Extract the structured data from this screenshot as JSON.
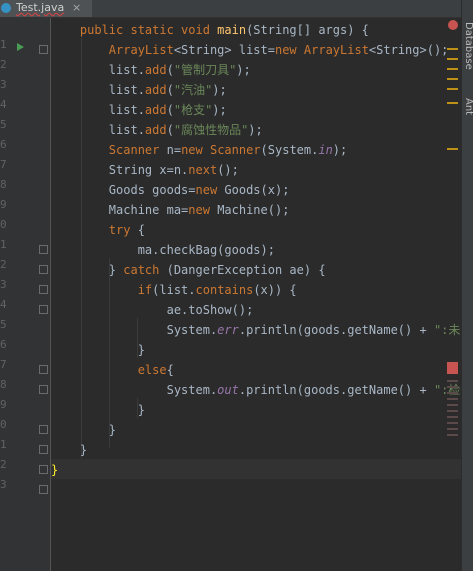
{
  "tab": {
    "label": "Test.java",
    "close": "×"
  },
  "line_numbers": [
    "1",
    "2",
    "3",
    "4",
    "5",
    "6",
    "7",
    "8",
    "9",
    "0",
    "1",
    "2",
    "3",
    "4",
    "5",
    "6",
    "7",
    "8",
    "9",
    "0",
    "1",
    "2",
    "3"
  ],
  "side_tools": {
    "database": "Database",
    "ant": "Ant"
  },
  "colors": {
    "error": "#c75450",
    "warning": "#be9117",
    "keyword": "#cc7832",
    "string": "#6a8759",
    "method": "#ffc66d"
  }
}
